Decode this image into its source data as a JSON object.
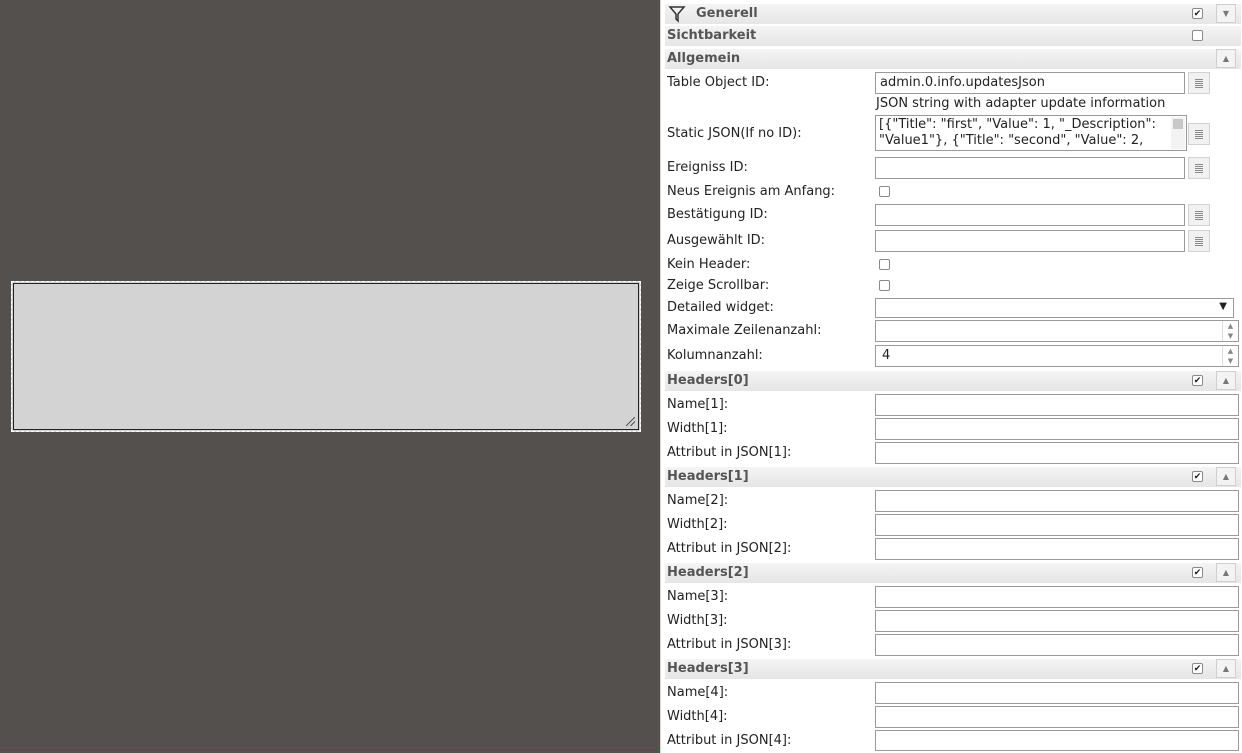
{
  "sections": {
    "generell": "Generell",
    "sichtbarkeit": "Sichtbarkeit",
    "allgemein": "Allgemein",
    "headers0": "Headers[0]",
    "headers1": "Headers[1]",
    "headers2": "Headers[2]",
    "headers3": "Headers[3]"
  },
  "fields": {
    "table_object_id_label": "Table Object ID:",
    "table_object_id_value": "admin.0.info.updatesJson",
    "table_object_id_hint": "JSON string with adapter update information",
    "static_json_label": "Static JSON(If no ID):",
    "static_json_line1": "[{\"Title\": \"first\", \"Value\": 1, \"_Description\":",
    "static_json_line2": "\"Value1\"}, {\"Title\": \"second\", \"Value\": 2,",
    "ereigniss_id_label": "Ereigniss ID:",
    "neues_ereignis_label": "Neus Ereignis am Anfang:",
    "bestaetigung_label": "Bestätigung ID:",
    "ausgewaehlt_label": "Ausgewählt ID:",
    "kein_header_label": "Kein Header:",
    "zeige_scrollbar_label": "Zeige Scrollbar:",
    "detailed_widget_label": "Detailed widget:",
    "max_zeilen_label": "Maximale Zeilenanzahl:",
    "kolumnanzahl_label": "Kolumnanzahl:",
    "kolumnanzahl_value": "4"
  },
  "headers": [
    {
      "name": "Name[1]:",
      "width": "Width[1]:",
      "attr": "Attribut in JSON[1]:"
    },
    {
      "name": "Name[2]:",
      "width": "Width[2]:",
      "attr": "Attribut in JSON[2]:"
    },
    {
      "name": "Name[3]:",
      "width": "Width[3]:",
      "attr": "Attribut in JSON[3]:"
    },
    {
      "name": "Name[4]:",
      "width": "Width[4]:",
      "attr": "Attribut in JSON[4]:"
    }
  ],
  "icons": {
    "filter": "filter-icon",
    "collapse": "chevron-up-icon",
    "expand": "chevron-down-icon",
    "picker": "list-icon"
  },
  "colors": {
    "canvas_bg": "#54504e",
    "widget_bg": "#d3d3d3",
    "section_title": "#555555"
  }
}
